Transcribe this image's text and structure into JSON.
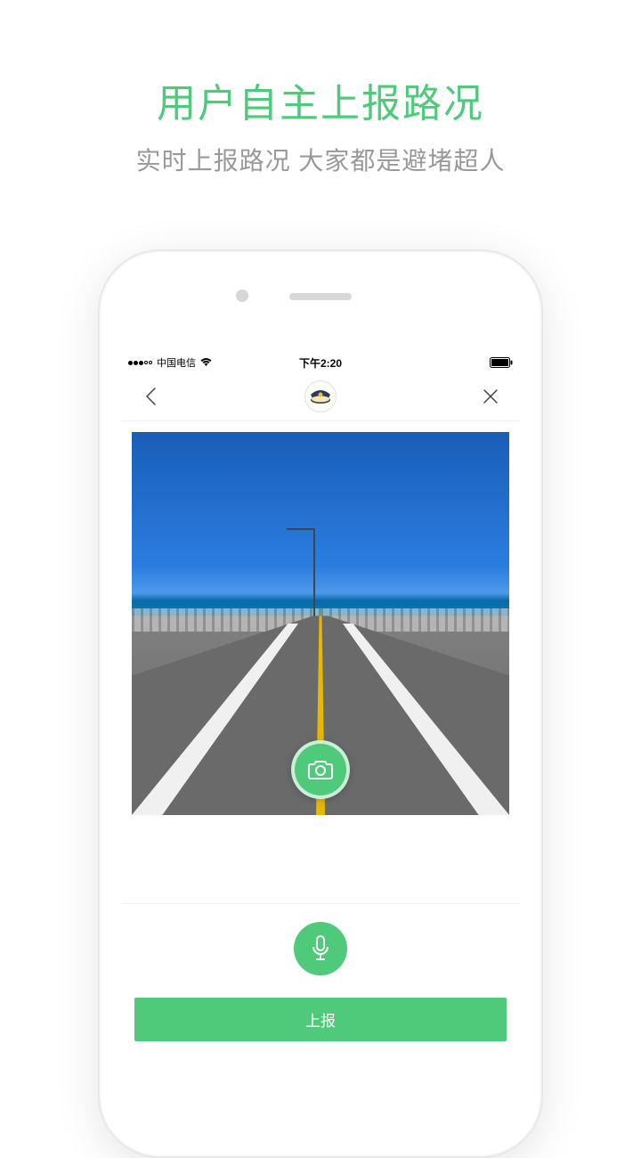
{
  "marketing": {
    "title": "用户自主上报路况",
    "subtitle": "实时上报路况 大家都是避堵超人"
  },
  "status_bar": {
    "carrier": "中国电信",
    "time": "下午2:20"
  },
  "icons": {
    "back": "back-chevron-icon",
    "close": "close-x-icon",
    "avatar": "police-cap-icon",
    "camera": "camera-icon",
    "mic": "microphone-icon",
    "wifi": "wifi-icon",
    "battery": "battery-icon"
  },
  "buttons": {
    "submit": "上报"
  },
  "colors": {
    "accent": "#4fc97a",
    "subtitle": "#999999"
  }
}
